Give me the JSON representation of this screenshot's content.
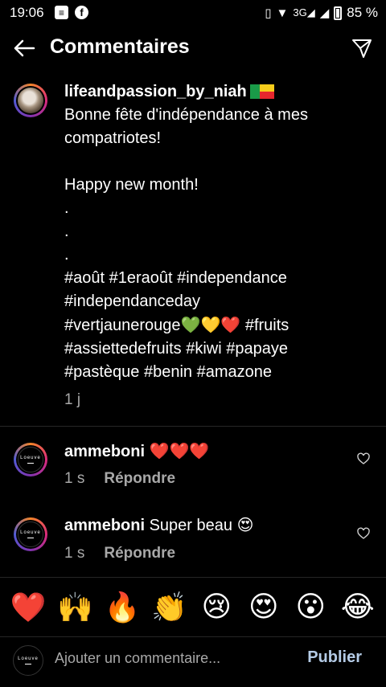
{
  "status_bar": {
    "time": "19:06",
    "notif_icons": [
      "message-icon",
      "facebook-icon"
    ],
    "network": "3G",
    "battery_level": 0.85,
    "battery_text": "85 %"
  },
  "header": {
    "title": "Commentaires"
  },
  "post": {
    "username": "lifeandpassion_by_niah",
    "lines": [
      "Bonne fête d'indépendance à mes",
      "compatriotes!",
      "",
      "Happy new month!",
      ".",
      ".",
      ".",
      "#août #1eraoût #independance",
      "#independanceday"
    ],
    "hashtag_line_prefix": "#vertjaunerouge",
    "hashtag_line_suffix": " #fruits",
    "hearts": [
      "💚",
      "💛",
      "❤️"
    ],
    "lines_after": [
      "#assiettedefruits #kiwi #papaye",
      "#pastèque #benin #amazone"
    ],
    "time": "1 j"
  },
  "comments": [
    {
      "username": "ammeboni",
      "text": "❤️❤️❤️",
      "time": "1 s",
      "reply_label": "Répondre",
      "avatar_text": "Loeuve"
    },
    {
      "username": "ammeboni",
      "text": "Super beau 😍",
      "time": "1 s",
      "reply_label": "Répondre",
      "avatar_text": "Loeuve"
    }
  ],
  "emoji_bar": [
    "❤️",
    "🙌",
    "🔥",
    "👏",
    "😢",
    "😍",
    "😮",
    "😂"
  ],
  "compose": {
    "placeholder": "Ajouter un commentaire...",
    "publish_label": "Publier",
    "avatar_text": "Loeuve"
  },
  "colors": {
    "background": "#000000",
    "secondary_text": "#a8a8a8",
    "publish": "#b4cbe6"
  }
}
